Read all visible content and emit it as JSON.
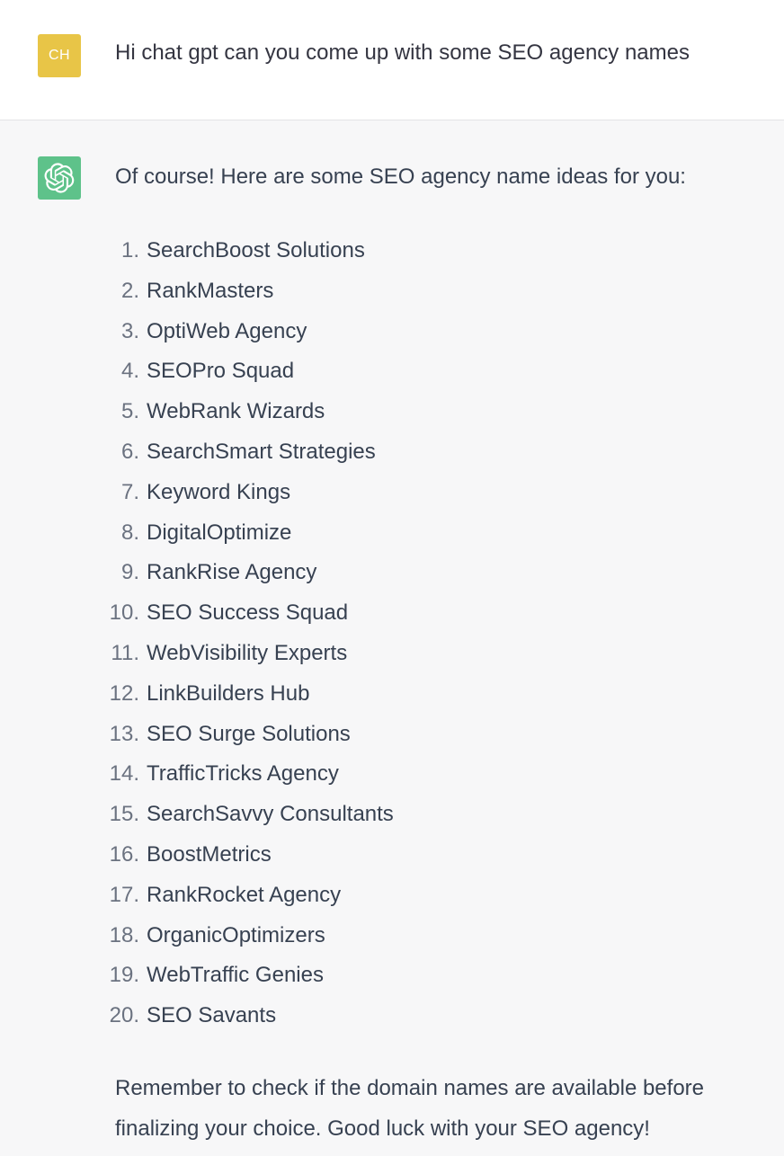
{
  "conversation": {
    "user_message": {
      "avatar_initials": "CH",
      "avatar_color": "#e8c547",
      "text": "Hi chat gpt can you come up with some SEO agency names"
    },
    "assistant_message": {
      "avatar_icon": "openai-logo-icon",
      "avatar_color": "#5ec28a",
      "intro": "Of course! Here are some SEO agency name ideas for you:",
      "items": [
        {
          "number": "1.",
          "name": "SearchBoost Solutions"
        },
        {
          "number": "2.",
          "name": "RankMasters"
        },
        {
          "number": "3.",
          "name": "OptiWeb Agency"
        },
        {
          "number": "4.",
          "name": "SEOPro Squad"
        },
        {
          "number": "5.",
          "name": "WebRank Wizards"
        },
        {
          "number": "6.",
          "name": "SearchSmart Strategies"
        },
        {
          "number": "7.",
          "name": "Keyword Kings"
        },
        {
          "number": "8.",
          "name": "DigitalOptimize"
        },
        {
          "number": "9.",
          "name": "RankRise Agency"
        },
        {
          "number": "10.",
          "name": "SEO Success Squad"
        },
        {
          "number": "11.",
          "name": "WebVisibility Experts"
        },
        {
          "number": "12.",
          "name": "LinkBuilders Hub"
        },
        {
          "number": "13.",
          "name": "SEO Surge Solutions"
        },
        {
          "number": "14.",
          "name": "TrafficTricks Agency"
        },
        {
          "number": "15.",
          "name": "SearchSavvy Consultants"
        },
        {
          "number": "16.",
          "name": "BoostMetrics"
        },
        {
          "number": "17.",
          "name": "RankRocket Agency"
        },
        {
          "number": "18.",
          "name": "OrganicOptimizers"
        },
        {
          "number": "19.",
          "name": "WebTraffic Genies"
        },
        {
          "number": "20.",
          "name": "SEO Savants"
        }
      ],
      "outro": "Remember to check if the domain names are available before finalizing your choice. Good luck with your SEO agency!"
    }
  }
}
